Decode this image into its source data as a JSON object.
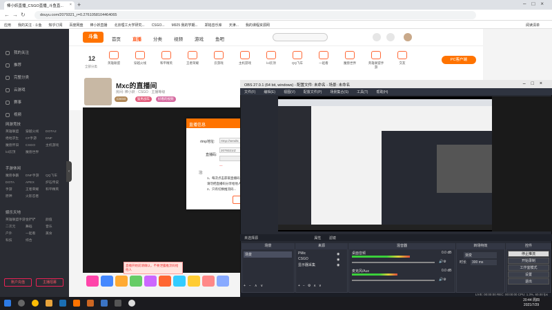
{
  "browser": {
    "tab_title": "棒小妖直播_CSGO直播_斗鱼直...",
    "url": "douyu.com/2079321_r=0.2761058104464065",
    "bookmarks": [
      "应用",
      "我的关注 · 斗鱼",
      "知乎订阅",
      "百度网盘",
      "棒小妖直播",
      "北京理工大学研究...",
      "CSGO...",
      "M925 我的学期...",
      "郑铭音乐库",
      "天津...",
      "我的课程资源网"
    ],
    "bookmarks_right": "阅读清单"
  },
  "douyu": {
    "logo": "斗鱼",
    "nav": [
      "首页",
      "直播",
      "分类",
      "视频",
      "游戏",
      "鱼吧"
    ],
    "active_nav_index": 1,
    "sidebar": [
      "我的关注",
      "推荐",
      "完整分类",
      "云游戏",
      "赛事",
      "视频"
    ],
    "sidebar_sections": [
      "网游竞技",
      "手游休闲",
      "娱乐天地"
    ],
    "sidebar_grid": [
      "英雄联盟",
      "穿越火线",
      "DOTA2",
      "绝地求生",
      "CF手游",
      "DNF",
      "魔兽怀旧",
      "CSGO",
      "主机游戏",
      "lol云顶",
      "魔兽世界",
      "魔兽争霸",
      "DNF手游",
      "QQ飞车",
      "DOTA",
      "APEX",
      "炉石传说",
      "手游",
      "王者荣耀",
      "和平精英",
      "原神",
      "火影忍者",
      "英雄联盟手游",
      "金铲铲",
      "颜值",
      "二次元",
      "舞蹈",
      "音乐",
      "户外",
      "一起看",
      "美食",
      "科技",
      "综合"
    ],
    "sidebar_buttons": [
      "账户充值",
      "主播招募"
    ],
    "category_count": "12",
    "category_count_label": "全部分类",
    "categories": [
      "英雄联盟",
      "穿越火线",
      "和平精英",
      "王者荣耀",
      "云游戏",
      "主机游戏",
      "lol云顶",
      "QQ飞车",
      "一起看",
      "魔兽世界",
      "英雄联盟手游",
      "交友"
    ],
    "pc_button": "PC客户端",
    "streamer_name": "Mxc的直播间",
    "room_meta": "房间: 棒小妖 · CSGO · 主播等级",
    "tags": [
      "CSGO",
      "猛男战车",
      "好看的视频"
    ],
    "toast": "直播开始前请确认，不要泄露推流码给他人"
  },
  "dialog": {
    "title": "直播信息",
    "rtmp_label": "rtmp地址:",
    "rtmp_value": "rtmp://sendtc",
    "code_label": "直播码:",
    "code_value": "2079321rZ",
    "notice_label": "注:",
    "notice_lines": [
      "1、每次点击获取直播码...",
      "请勿把直播码分享给他人...",
      "2、只有切换推流码..."
    ]
  },
  "obs": {
    "title": "OBS 27.0.1 (64 bit, windows) - 配置文件: 未命名 - 场景: 未命名",
    "menu": [
      "文件(F)",
      "编辑(E)",
      "视图(V)",
      "配置文件(P)",
      "场景集合(S)",
      "工具(T)",
      "帮助(H)"
    ],
    "bar": [
      "未选择源",
      "属性",
      "滤镜"
    ],
    "docks": [
      "场景",
      "来源",
      "混音器",
      "转场特效",
      "控件"
    ],
    "scene": "场景",
    "sources": [
      "PMic",
      "CSGO",
      "显示器采集"
    ],
    "mixer": [
      {
        "name": "桌面音频",
        "db": "0.0 dB",
        "level": 0.7
      },
      {
        "name": "麦克风/Aux",
        "db": "0.0 dB",
        "level": 0.55
      }
    ],
    "transition": {
      "type": "渐变",
      "duration_label": "时长",
      "duration": "300 ms"
    },
    "controls": [
      "停止推流",
      "开始录制",
      "工作室模式",
      "设置",
      "退出"
    ],
    "status": "LIVE: 00:00:00   REC: 00:00:00   CPU: 1.3%, 60.00 fps"
  },
  "taskbar": {
    "time": "20:44 周四",
    "date": "2021/7/29"
  },
  "colors": {
    "accent": "#ff7300",
    "obs_bg": "#272a33"
  }
}
